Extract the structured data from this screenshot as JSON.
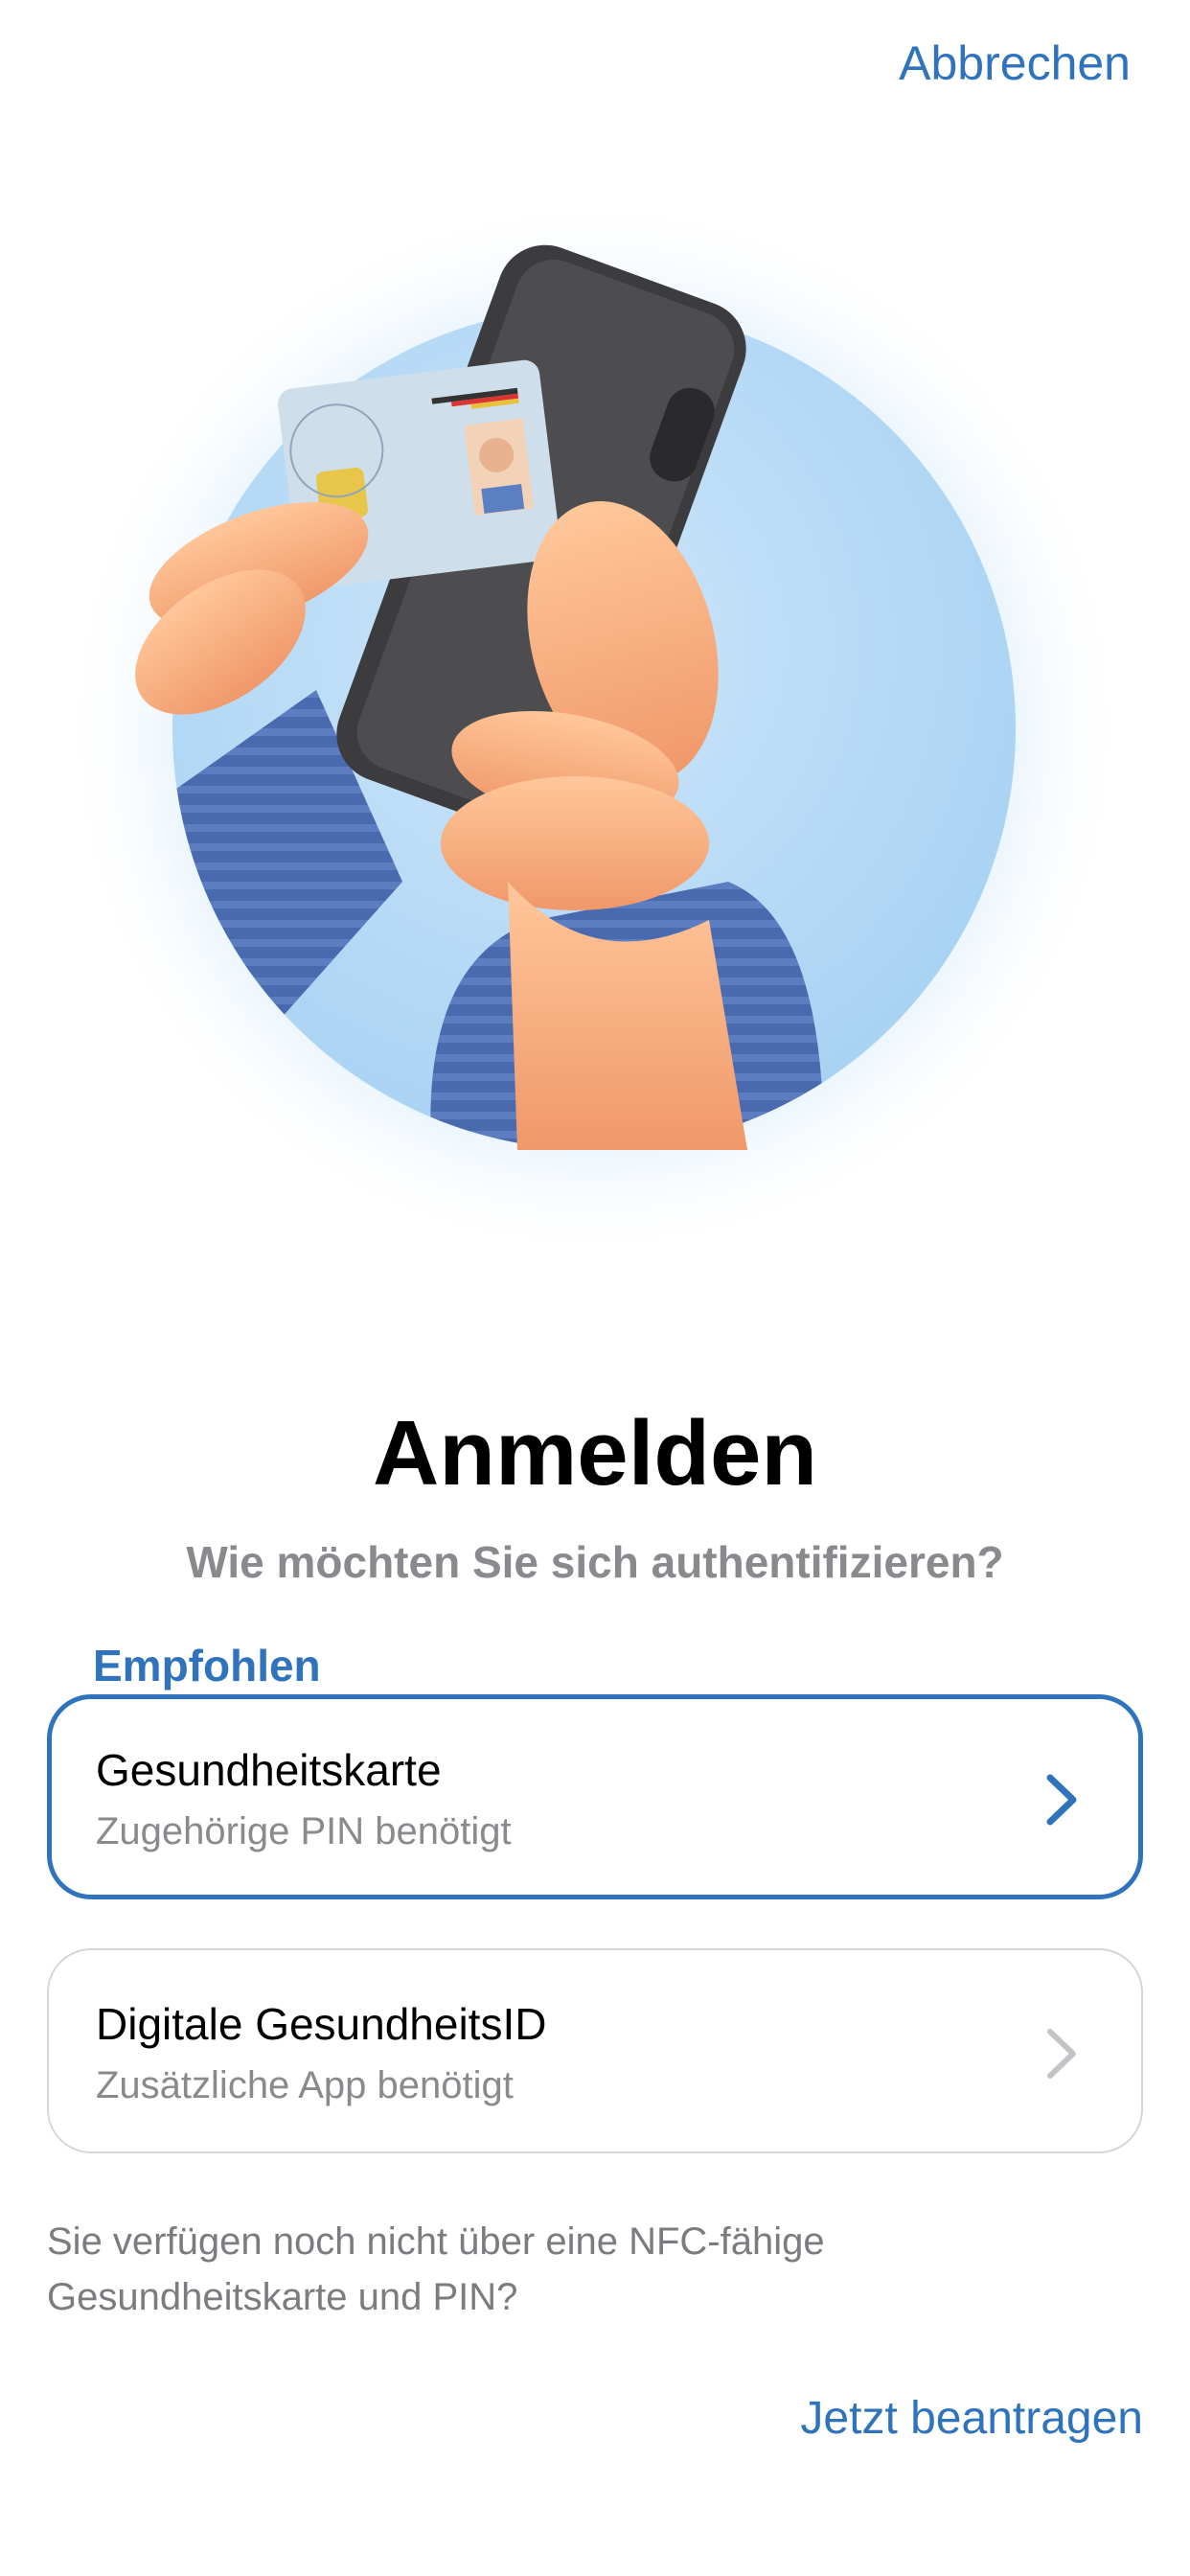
{
  "nav": {
    "cancel_label": "Abbrechen"
  },
  "header": {
    "title": "Anmelden",
    "subtitle": "Wie möchten Sie sich authentifizieren?"
  },
  "section": {
    "recommended_label": "Empfohlen"
  },
  "options": [
    {
      "title": "Gesundheitskarte",
      "subtitle": "Zugehörige PIN benötigt",
      "icon": "chevron-right-icon"
    },
    {
      "title": "Digitale GesundheitsID",
      "subtitle": "Zusätzliche App benötigt",
      "icon": "chevron-right-icon"
    }
  ],
  "footer": {
    "note": "Sie verfügen noch nicht über eine NFC-fähige Gesundheitskarte und PIN?",
    "apply_label": "Jetzt beantragen"
  },
  "colors": {
    "accent": "#2f73bd",
    "secondary_text": "#8a8a8e",
    "card_border": "#d6d6da"
  }
}
